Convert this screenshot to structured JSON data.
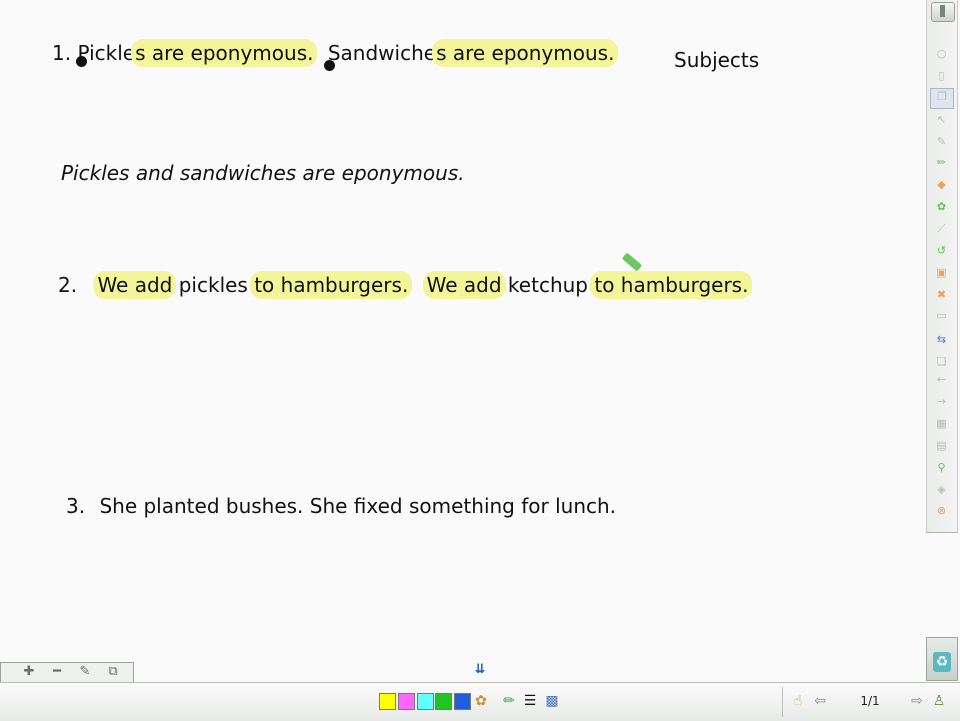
{
  "line1": {
    "number": "1.",
    "part1_plain": "Pickle",
    "part1_hl": "s are eponymous.",
    "part2_plain": "Sandwiche",
    "part2_hl": "s are eponymous."
  },
  "heading_subjects": "Subjects",
  "combined": "Pickles and sandwiches are eponymous.",
  "line2": {
    "number": "2.",
    "hl1": "We add",
    "plain1": " pickles",
    "hl2": "to hamburgers.",
    "hl3": "We add",
    "plain2": " ketchup",
    "hl4": "to hamburgers."
  },
  "line3": {
    "number": "3.",
    "text": "She planted bushes.  She fixed something for lunch."
  },
  "toolbar": {
    "page_indicator": "1/1",
    "color_swatches": [
      "#ffff00",
      "#ff66ff",
      "#66ffff",
      "#22c322",
      "#1f5fdc"
    ]
  },
  "icons": {
    "right_toolbar": [
      "scroll-up-icon",
      "circle-icon",
      "pointer-icon",
      "page-icon",
      "select-icon",
      "magic-wand-icon",
      "pen-icon",
      "eraser-icon",
      "paint-icon",
      "ruler-icon",
      "undo-icon",
      "image-icon",
      "delete-icon",
      "blank-page-icon",
      "page-sorter-icon",
      "copy-icon",
      "back-icon",
      "forward-icon",
      "table-icon",
      "save-icon",
      "screen-shade-icon",
      "spotlight-icon",
      "close-icon"
    ]
  }
}
